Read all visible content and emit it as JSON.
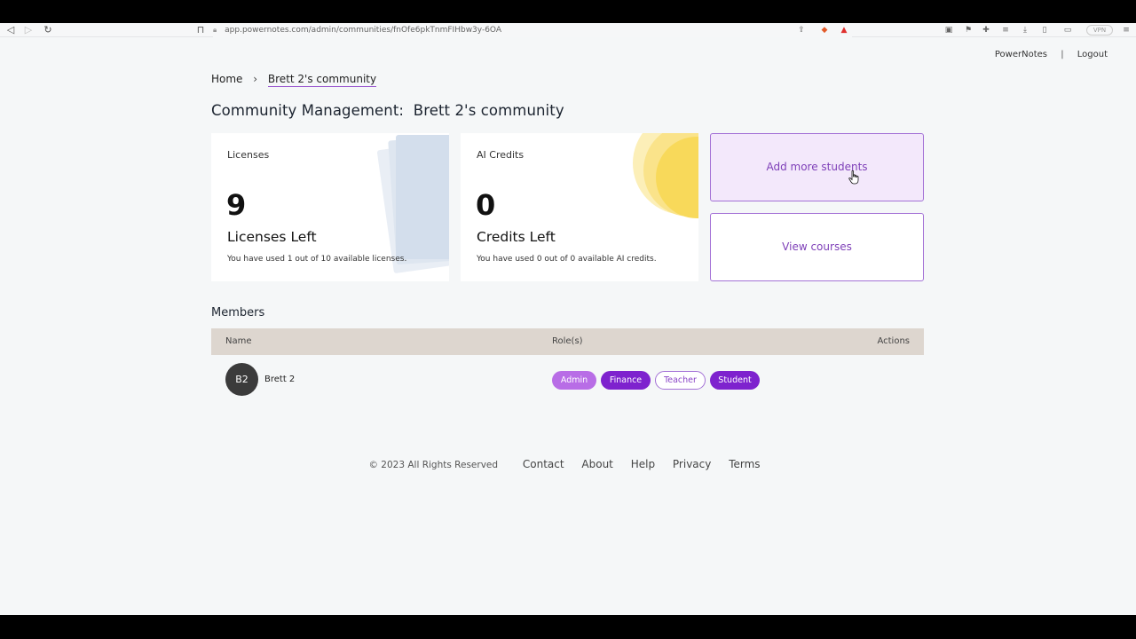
{
  "browser": {
    "url": "app.powernotes.com/admin/communities/fnOfe6pkTnmFIHbw3y-6OA",
    "vpn_label": "VPN"
  },
  "topnav": {
    "brand": "PowerNotes",
    "separator": "|",
    "logout": "Logout"
  },
  "breadcrumb": {
    "home": "Home",
    "separator": "›",
    "current": "Brett 2's community"
  },
  "page_title": "Community Management:  Brett 2's community",
  "licenses_card": {
    "label": "Licenses",
    "count": "9",
    "subtitle": "Licenses Left",
    "note": "You have used 1 out of 10 available licenses."
  },
  "ai_card": {
    "label": "AI Credits",
    "count": "0",
    "subtitle": "Credits Left",
    "note": "You have used 0 out of 0 available AI credits."
  },
  "actions": {
    "add_students": "Add more students",
    "view_courses": "View courses"
  },
  "members": {
    "title": "Members",
    "columns": {
      "name": "Name",
      "roles": "Role(s)",
      "actions": "Actions"
    },
    "rows": [
      {
        "initials": "B2",
        "name": "Brett 2",
        "roles": [
          "Admin",
          "Finance",
          "Teacher",
          "Student"
        ]
      }
    ]
  },
  "footer": {
    "copyright": "© 2023 All Rights Reserved",
    "links": [
      "Contact",
      "About",
      "Help",
      "Privacy",
      "Terms"
    ]
  },
  "colors": {
    "accent_purple": "#7e22ce",
    "light_purple": "#b86de6",
    "button_bg": "#f3e8fb",
    "table_header": "#ddd6cf",
    "ai_circle": "#f8d95a",
    "license_paper": "#d3deec"
  }
}
